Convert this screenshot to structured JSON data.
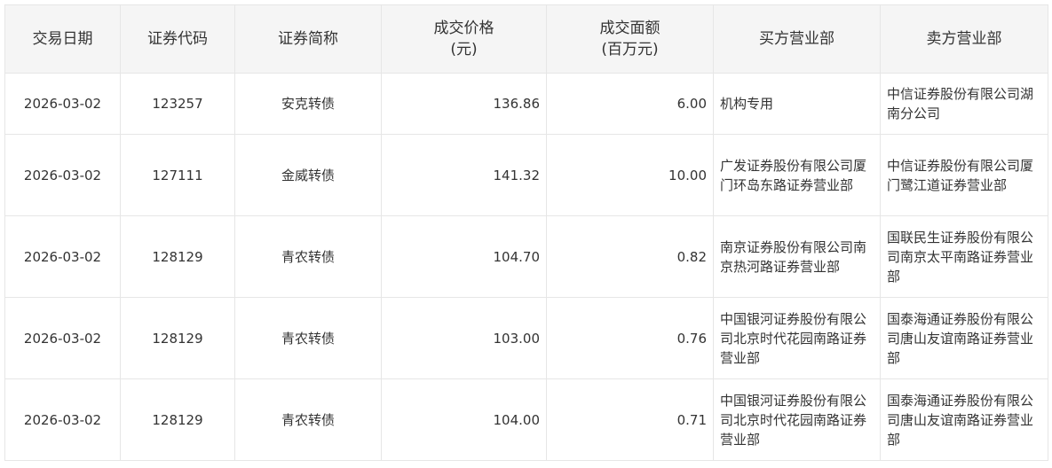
{
  "table": {
    "headers": [
      {
        "line1": "交易日期",
        "line2": ""
      },
      {
        "line1": "证券代码",
        "line2": ""
      },
      {
        "line1": "证券简称",
        "line2": ""
      },
      {
        "line1": "成交价格",
        "line2": "(元)"
      },
      {
        "line1": "成交面额",
        "line2": "(百万元)"
      },
      {
        "line1": "买方营业部",
        "line2": ""
      },
      {
        "line1": "卖方营业部",
        "line2": ""
      }
    ],
    "rows": [
      {
        "date": "2026-03-02",
        "code": "123257",
        "name": "安克转债",
        "price": "136.86",
        "amount": "6.00",
        "buyer": "机构专用",
        "seller": "中信证券股份有限公司湖南分公司"
      },
      {
        "date": "2026-03-02",
        "code": "127111",
        "name": "金威转债",
        "price": "141.32",
        "amount": "10.00",
        "buyer": "广发证券股份有限公司厦门环岛东路证券营业部",
        "seller": "中信证券股份有限公司厦门鹭江道证券营业部"
      },
      {
        "date": "2026-03-02",
        "code": "128129",
        "name": "青农转债",
        "price": "104.70",
        "amount": "0.82",
        "buyer": "南京证券股份有限公司南京热河路证券营业部",
        "seller": "国联民生证券股份有限公司南京太平南路证券营业部"
      },
      {
        "date": "2026-03-02",
        "code": "128129",
        "name": "青农转债",
        "price": "103.00",
        "amount": "0.76",
        "buyer": "中国银河证券股份有限公司北京时代花园南路证券营业部",
        "seller": "国泰海通证券股份有限公司唐山友谊南路证券营业部"
      },
      {
        "date": "2026-03-02",
        "code": "128129",
        "name": "青农转债",
        "price": "104.00",
        "amount": "0.71",
        "buyer": "中国银河证券股份有限公司北京时代花园南路证券营业部",
        "seller": "国泰海通证券股份有限公司唐山友谊南路证券营业部"
      }
    ]
  }
}
